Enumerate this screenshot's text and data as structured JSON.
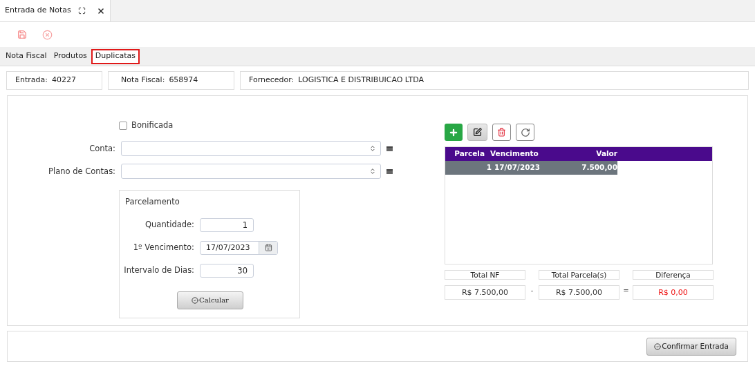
{
  "doc_tab": {
    "title": "Entrada de Notas",
    "selected": true
  },
  "subtabs": [
    {
      "label": "Nota Fiscal",
      "selected": false
    },
    {
      "label": "Produtos",
      "selected": false
    },
    {
      "label": "Duplicatas",
      "selected": true
    }
  ],
  "info": [
    {
      "label": "Entrada:",
      "value": "40227"
    },
    {
      "label": "Nota Fiscal:",
      "value": "658974"
    },
    {
      "label": "Fornecedor:",
      "value": "LOGISTICA E DISTRIBUICAO LTDA"
    }
  ],
  "bonificada": {
    "label": "Bonificada",
    "checked": false
  },
  "conta": {
    "label": "Conta:"
  },
  "plano": {
    "label": "Plano de Contas:"
  },
  "parcelamento": {
    "title": "Parcelamento",
    "quantidade": {
      "label": "Quantidade:",
      "value": "1"
    },
    "vencimento": {
      "label": "1º Vencimento:",
      "value": "17/07/2023"
    },
    "intervalo": {
      "label": "Intervalo de Dias:",
      "value": "30"
    },
    "button": "Calcular"
  },
  "table": {
    "columns": [
      "Parcela",
      "Vencimento",
      "Valor"
    ],
    "rows": [
      {
        "cells": [
          "1",
          "17/07/2023",
          "7.500,00"
        ],
        "selected": true
      }
    ]
  },
  "totals": [
    {
      "label": "Total NF",
      "value": "R$ 7.500,00",
      "alert": false
    },
    {
      "label": "Total Parcela(s)",
      "value": "R$ 7.500,00",
      "alert": false
    },
    {
      "label": "Diferença",
      "value": "R$ 0,00",
      "alert": true
    }
  ],
  "operators": [
    "-",
    "="
  ],
  "confirm": "Confirmar Entrada"
}
